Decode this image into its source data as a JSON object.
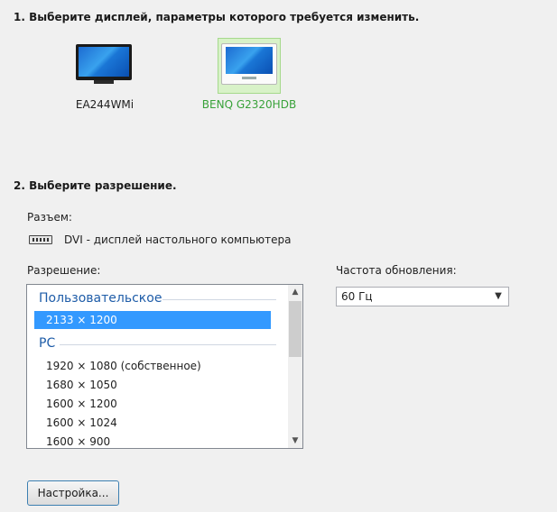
{
  "step1": {
    "heading": "1. Выберите дисплей, параметры которого требуется изменить."
  },
  "displays": [
    {
      "name": "EA244WMi",
      "selected": false
    },
    {
      "name": "BENQ G2320HDB",
      "selected": true
    }
  ],
  "step2": {
    "heading": "2. Выберите разрешение.",
    "connector_label": "Разъем:",
    "connector_value": "DVI - дисплей настольного компьютера",
    "resolution_label": "Разрешение:",
    "refresh_label": "Частота обновления:",
    "refresh_value": "60 Гц"
  },
  "resolution_list": {
    "groups": [
      {
        "header": "Пользовательское",
        "items": [
          "2133 × 1200"
        ]
      },
      {
        "header": "PC",
        "items": [
          "1920 × 1080 (собственное)",
          "1680 × 1050",
          "1600 × 1200",
          "1600 × 1024",
          "1600 × 900"
        ]
      }
    ],
    "selected": "2133 × 1200"
  },
  "buttons": {
    "customize": "Настройка..."
  },
  "icons": {
    "monitor_1": "monitor-black-icon",
    "monitor_2": "monitor-white-icon",
    "connector": "dvi-connector-icon",
    "dropdown": "chevron-down-icon",
    "scroll_up": "chevron-up-icon",
    "scroll_down": "chevron-down-icon"
  },
  "colors": {
    "selected_item": "#3399ff",
    "selected_display_bg": "#d8f2c8",
    "selected_display_text": "#39a23a",
    "group_header": "#1e5ca8"
  }
}
